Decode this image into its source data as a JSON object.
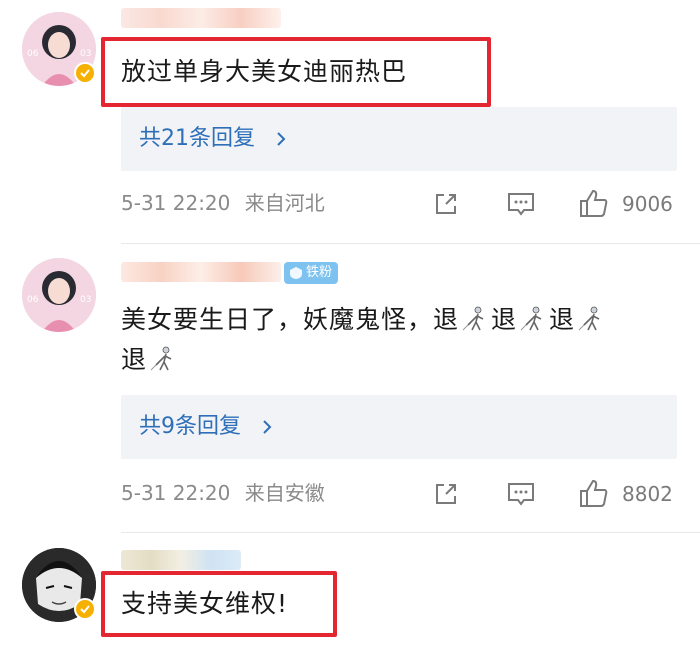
{
  "comments": [
    {
      "text": "放过单身大美女迪丽热巴",
      "replies_label": "共21条回复",
      "time": "5-31 22:20",
      "location": "来自河北",
      "likes": "9006"
    },
    {
      "fan_badge": "铁粉",
      "text_parts": [
        "美女要生日了，妖魔鬼怪，退",
        "退",
        "退",
        "退"
      ],
      "replies_label": "共9条回复",
      "time": "5-31 22:20",
      "location": "来自安徽",
      "likes": "8802"
    },
    {
      "text": "支持美女维权!"
    }
  ],
  "icons": {
    "verified": "verified-badge-icon",
    "share": "share-icon",
    "comment": "comment-icon",
    "like": "thumbs-up-icon",
    "fencer": "fencer-emoji-icon",
    "chevron": "chevron-right-icon"
  },
  "colors": {
    "highlight_box": "#e3262f",
    "reply_link": "#2e6fb8",
    "verified": "#f6b000",
    "fan_badge": "#7ec3f0"
  }
}
